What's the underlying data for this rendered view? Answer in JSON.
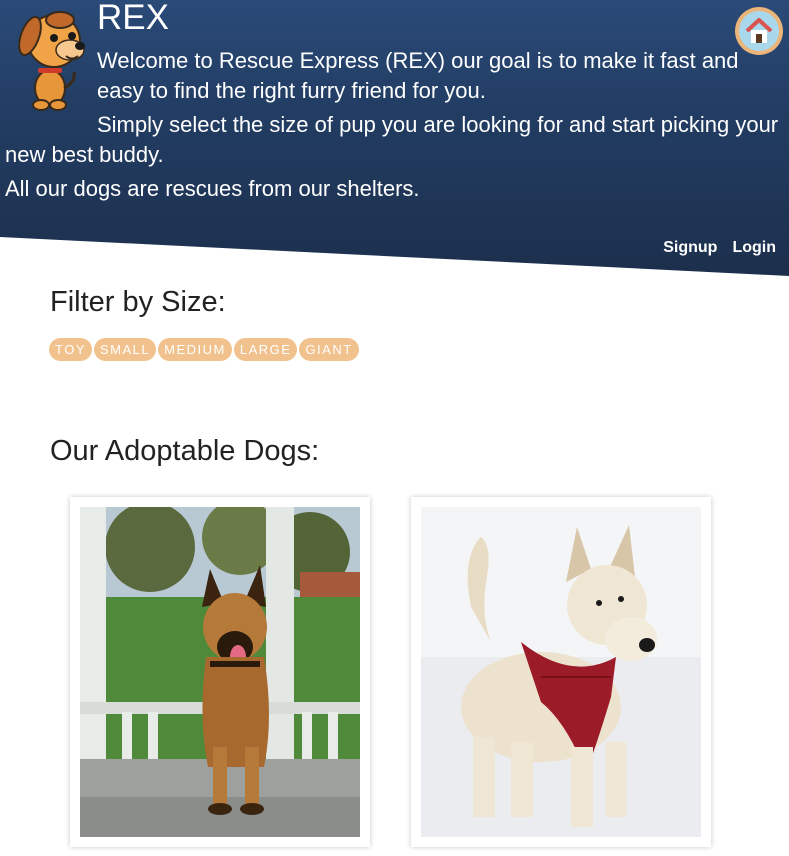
{
  "header": {
    "brand": "REX",
    "intro_line1": "Welcome to Rescue Express (REX) our goal is to make it fast and easy to find the right furry friend for you.",
    "intro_line2": "Simply select the size of pup you are looking for and start picking your new best buddy.",
    "intro_line3": "All our dogs are rescues from our shelters.",
    "home_icon": "home-icon",
    "logo_icon": "cartoon-dog-logo"
  },
  "nav": {
    "signup": "Signup",
    "login": "Login"
  },
  "filter": {
    "title": "Filter by Size:",
    "sizes": [
      "TOY",
      "SMALL",
      "MEDIUM",
      "LARGE",
      "GIANT"
    ]
  },
  "dogs": {
    "title": "Our Adoptable Dogs:",
    "cards": [
      {
        "photo": "belgian-malinois-photo"
      },
      {
        "photo": "scottish-terrier-photo"
      }
    ]
  },
  "colors": {
    "header_top": "#2a4a78",
    "header_bottom": "#1c2f4c",
    "chip": "#f2c28e",
    "home_ring": "#ebb57a",
    "home_fill": "#a9d8ec"
  }
}
